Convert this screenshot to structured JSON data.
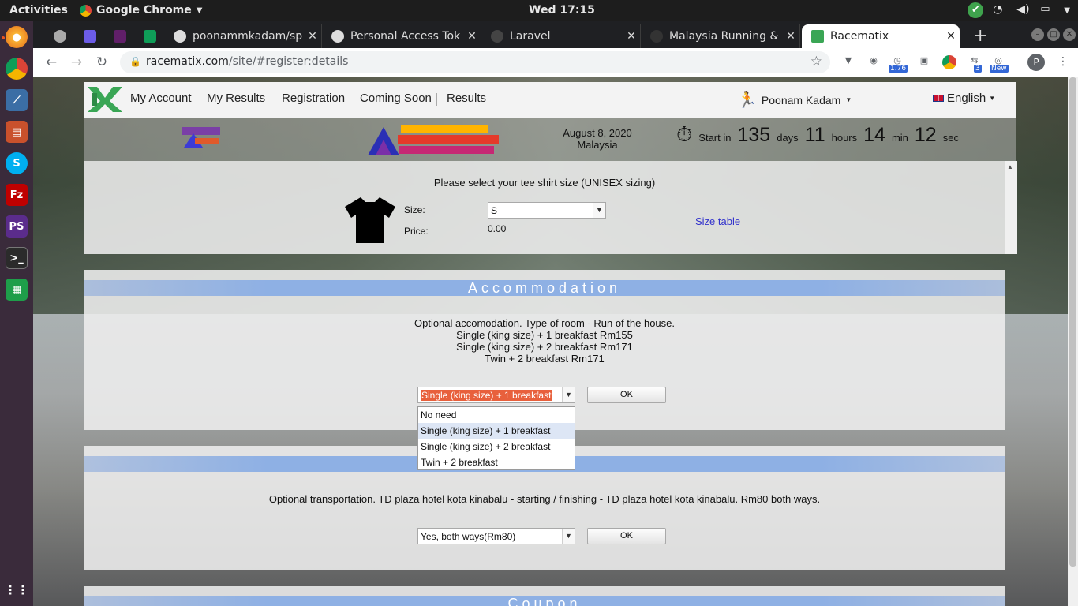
{
  "topbar": {
    "activities": "Activities",
    "app_name": "Google Chrome",
    "clock": "Wed 17:15"
  },
  "tabs": [
    {
      "title": "poonammkadam/sp",
      "icon": "github-icon"
    },
    {
      "title": "Personal Access Tok",
      "icon": "github-icon"
    },
    {
      "title": "Laravel",
      "icon": "laravel-icon"
    },
    {
      "title": "Malaysia Running &",
      "icon": "globe-icon"
    },
    {
      "title": "Racematix",
      "icon": "racematix-icon",
      "active": true
    }
  ],
  "omnibox": {
    "host": "racematix.com",
    "path": "/site/#register:details"
  },
  "extensions": {
    "badge_176": "1.76",
    "badge_3": "3",
    "badge_new": "New",
    "profile": "P"
  },
  "nav": {
    "links": [
      "My Account",
      "My Results",
      "Registration",
      "Coming Soon",
      "Results"
    ],
    "user": "Poonam Kadam",
    "language": "English"
  },
  "event": {
    "date": "August 8, 2020",
    "country": "Malaysia",
    "start_label": "Start in",
    "days": "135",
    "days_label": "days",
    "hours": "11",
    "hours_label": "hours",
    "min": "14",
    "min_label": "min",
    "sec": "12",
    "sec_label": "sec"
  },
  "tshirt": {
    "prompt": "Please select your tee shirt size (UNISEX sizing)",
    "size_label": "Size:",
    "size_value": "S",
    "price_label": "Price:",
    "price_value": "0.00",
    "size_table": "Size table"
  },
  "accommodation": {
    "heading": "Accommodation",
    "line1": "Optional accomodation. Type of room - Run of the house.",
    "line2": "Single (king size) + 1 breakfast Rm155",
    "line3": "Single (king size) + 2 breakfast Rm171",
    "line4": "Twin + 2 breakfast Rm171",
    "selected": "Single (king size) + 1 breakfast",
    "ok": "OK",
    "options": [
      "No need",
      "Single (king size) + 1 breakfast",
      "Single (king size) + 2 breakfast",
      "Twin + 2 breakfast"
    ]
  },
  "transportation": {
    "heading_visible": "ation",
    "text": "Optional transportation. TD plaza hotel kota kinabalu - starting / finishing - TD plaza hotel kota kinabalu. Rm80 both ways.",
    "selected": "Yes, both ways(Rm80)",
    "ok": "OK"
  },
  "coupon": {
    "heading": "Coupon"
  }
}
